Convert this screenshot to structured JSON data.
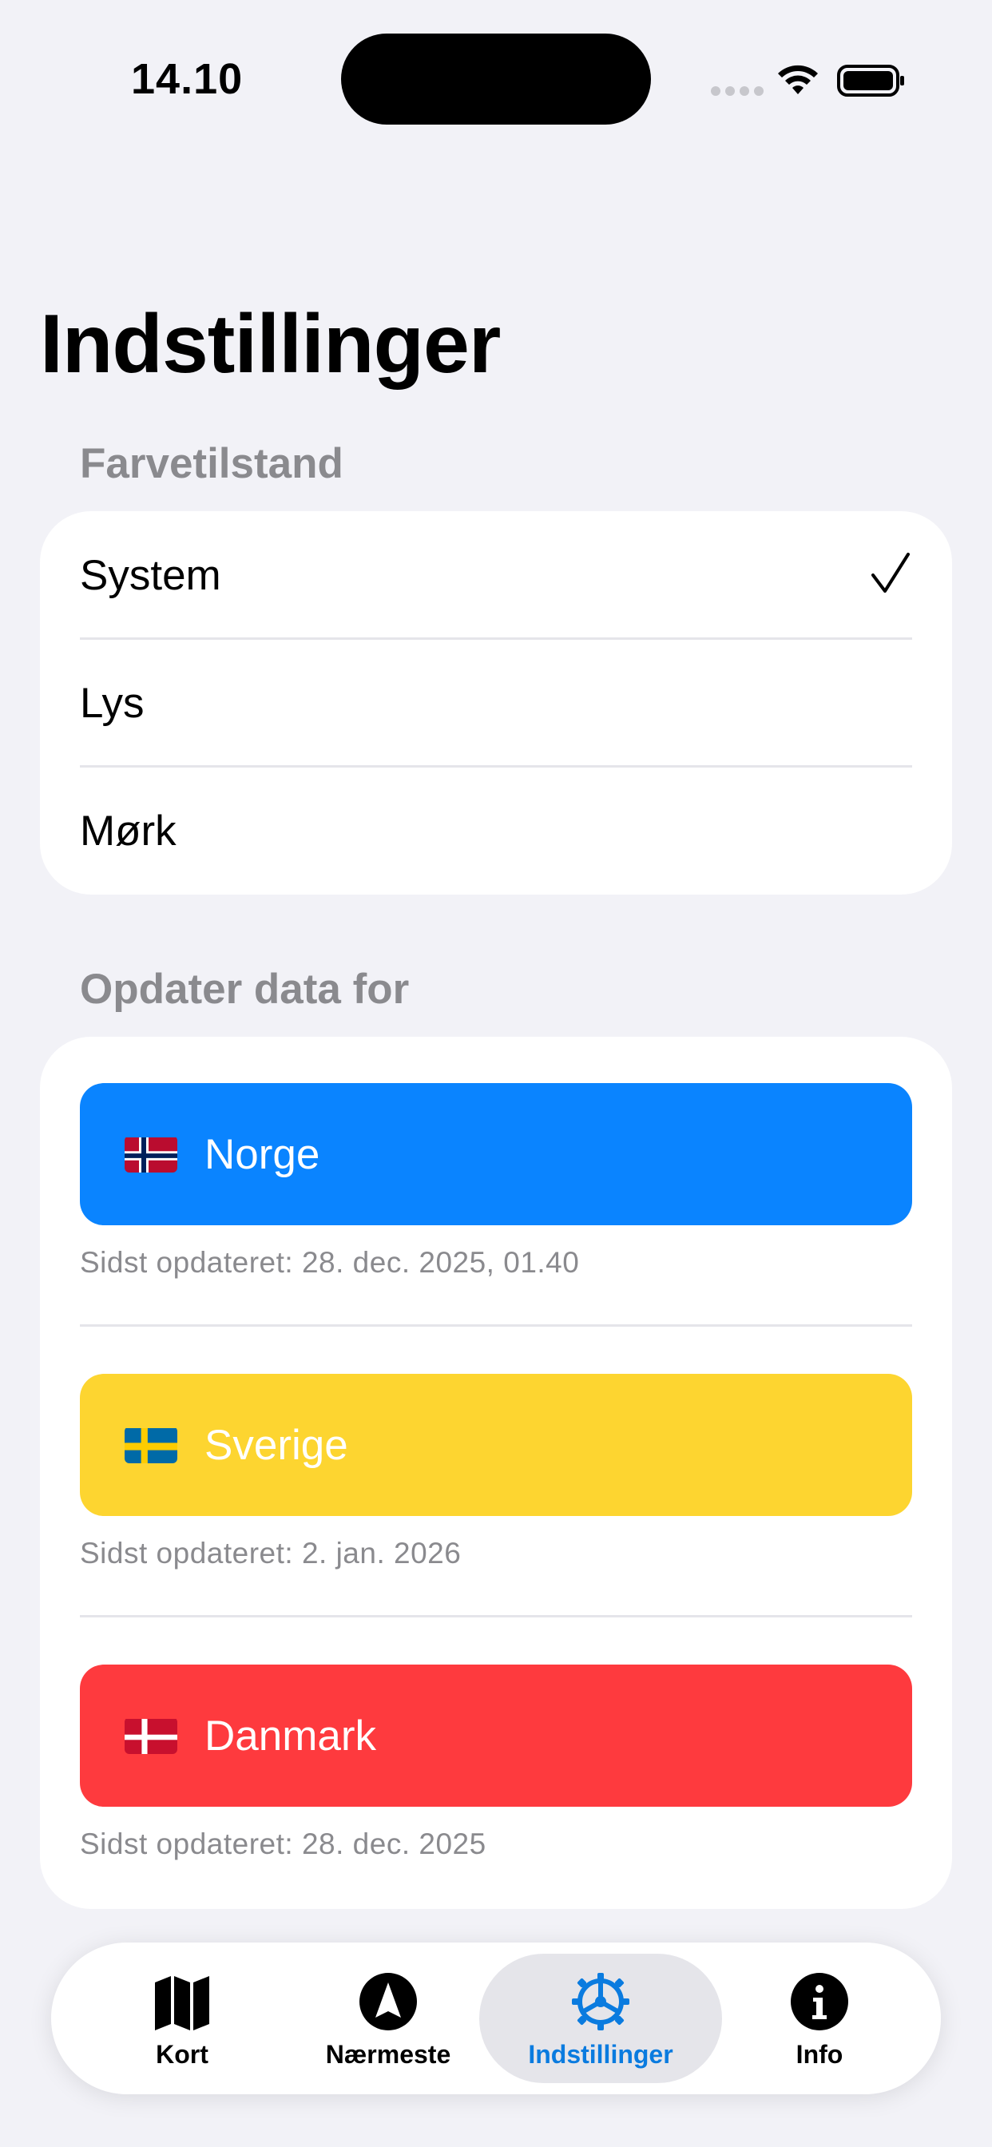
{
  "status_bar": {
    "time": "14.10"
  },
  "page_title": "Indstillinger",
  "color_mode": {
    "header": "Farvetilstand",
    "options": [
      {
        "label": "System",
        "selected": true
      },
      {
        "label": "Lys",
        "selected": false
      },
      {
        "label": "Mørk",
        "selected": false
      }
    ]
  },
  "update_data": {
    "header": "Opdater data for",
    "countries": [
      {
        "label": "Norge",
        "updated": "Sidst opdateret: 28. dec. 2025, 01.40",
        "color": "#0a84ff",
        "flag": "norway-flag-icon"
      },
      {
        "label": "Sverige",
        "updated": "Sidst opdateret: 2. jan. 2026",
        "color": "#fdd530",
        "flag": "sweden-flag-icon"
      },
      {
        "label": "Danmark",
        "updated": "Sidst opdateret: 28. dec. 2025",
        "color": "#fe3a3e",
        "flag": "denmark-flag-icon"
      }
    ]
  },
  "tab_bar": {
    "tabs": [
      {
        "label": "Kort",
        "icon": "map-icon",
        "selected": false
      },
      {
        "label": "Nærmeste",
        "icon": "navigation-arrow-icon",
        "selected": false
      },
      {
        "label": "Indstillinger",
        "icon": "gear-icon",
        "selected": true
      },
      {
        "label": "Info",
        "icon": "info-icon",
        "selected": false
      }
    ],
    "accent": "#0a7bdf"
  }
}
